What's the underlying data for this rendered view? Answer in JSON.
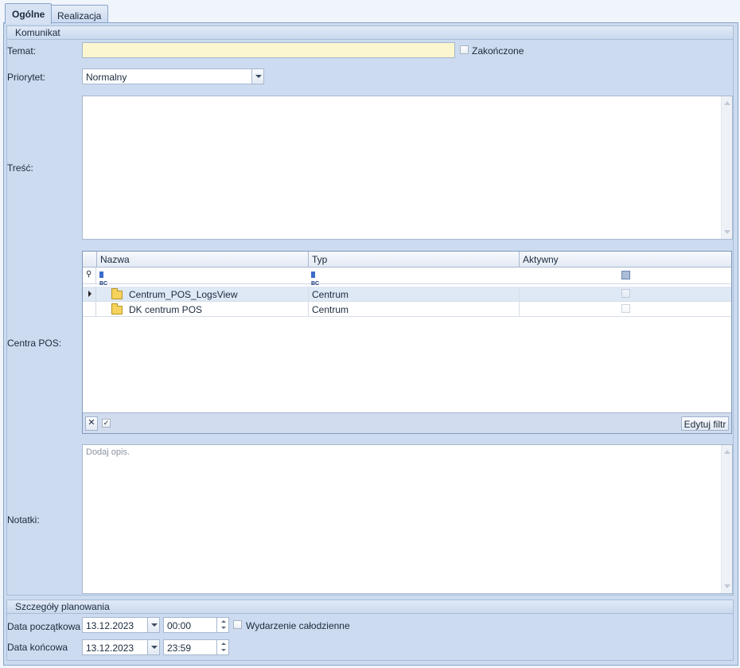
{
  "tabs": [
    {
      "label": "Ogólne",
      "active": true
    },
    {
      "label": "Realizacja",
      "active": false
    }
  ],
  "komunikat": {
    "header": "Komunikat",
    "temat_label": "Temat:",
    "temat_value": "",
    "zakonczone_label": "Zakończone",
    "priorytet_label": "Priorytet:",
    "priorytet_value": "Normalny",
    "tresc_label": "Treść:",
    "centra_label": "Centra POS:",
    "notatki_label": "Notatki:",
    "notatki_placeholder": "Dodaj opis."
  },
  "grid": {
    "columns": [
      "Nazwa",
      "Typ",
      "Aktywny"
    ],
    "filter_abc": "BC",
    "rows": [
      {
        "nazwa": "Centrum_POS_LogsView",
        "typ": "Centrum",
        "aktywny": false,
        "selected": true
      },
      {
        "nazwa": "DK centrum POS",
        "typ": "Centrum",
        "aktywny": false,
        "selected": false
      }
    ],
    "edit_filter_label": "Edytuj filtr"
  },
  "planowanie": {
    "header": "Szczegóły planowania",
    "start_label": "Data początkowa",
    "start_date": "13.12.2023",
    "start_time": "00:00",
    "allday_label": "Wydarzenie całodzienne",
    "end_label": "Data końcowa",
    "end_date": "13.12.2023",
    "end_time": "23:59"
  }
}
